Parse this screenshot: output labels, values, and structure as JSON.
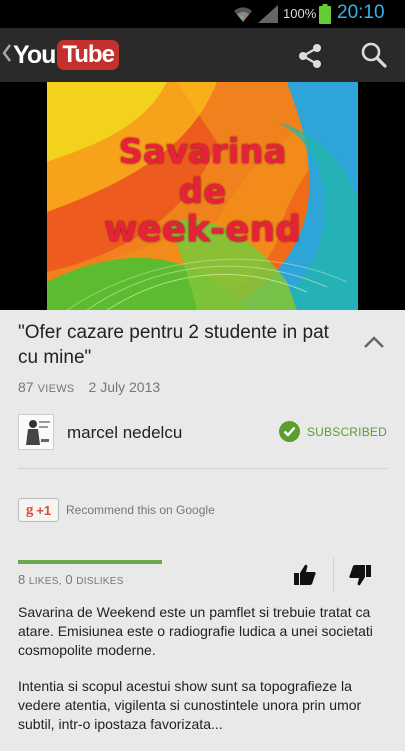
{
  "statusbar": {
    "battery_pct": "100%",
    "clock": "20:10",
    "clock_color": "#34b5e5"
  },
  "actionbar": {
    "logo_you": "You",
    "logo_tube": "Tube",
    "logo_tube_color": "#c4302b",
    "icons": [
      "chevron-left-icon",
      "share-icon",
      "search-icon"
    ]
  },
  "video": {
    "thumbnail_lines": [
      "Savarina",
      "de",
      "week-end"
    ]
  },
  "details": {
    "title": "\"Ofer cazare pentru 2 studente in pat cu mine\"",
    "views_count": "87",
    "views_label": "VIEWS",
    "date": "2 July 2013",
    "channel_name": "marcel nedelcu",
    "subscribed_label": "SUBSCRIBED",
    "subscribed_color": "#5a9e2e",
    "gplus_label": "+1",
    "gplus_text": "Recommend this on Google",
    "likes_count": "8",
    "likes_label": "LIKES,",
    "dislikes_count": "0",
    "dislikes_label": "DISLIKES",
    "like_ratio": 1.0,
    "description": [
      "Savarina de Weekend este un pamflet si trebuie tratat ca atare. Emisiunea este o radiografie ludica a unei societati cosmopolite moderne.",
      "Intentia si scopul acestui show sunt sa topografieze la vedere atentia, vigilenta si cunostintele unora prin umor subtil, intr-o ipostaza favorizata..."
    ]
  }
}
